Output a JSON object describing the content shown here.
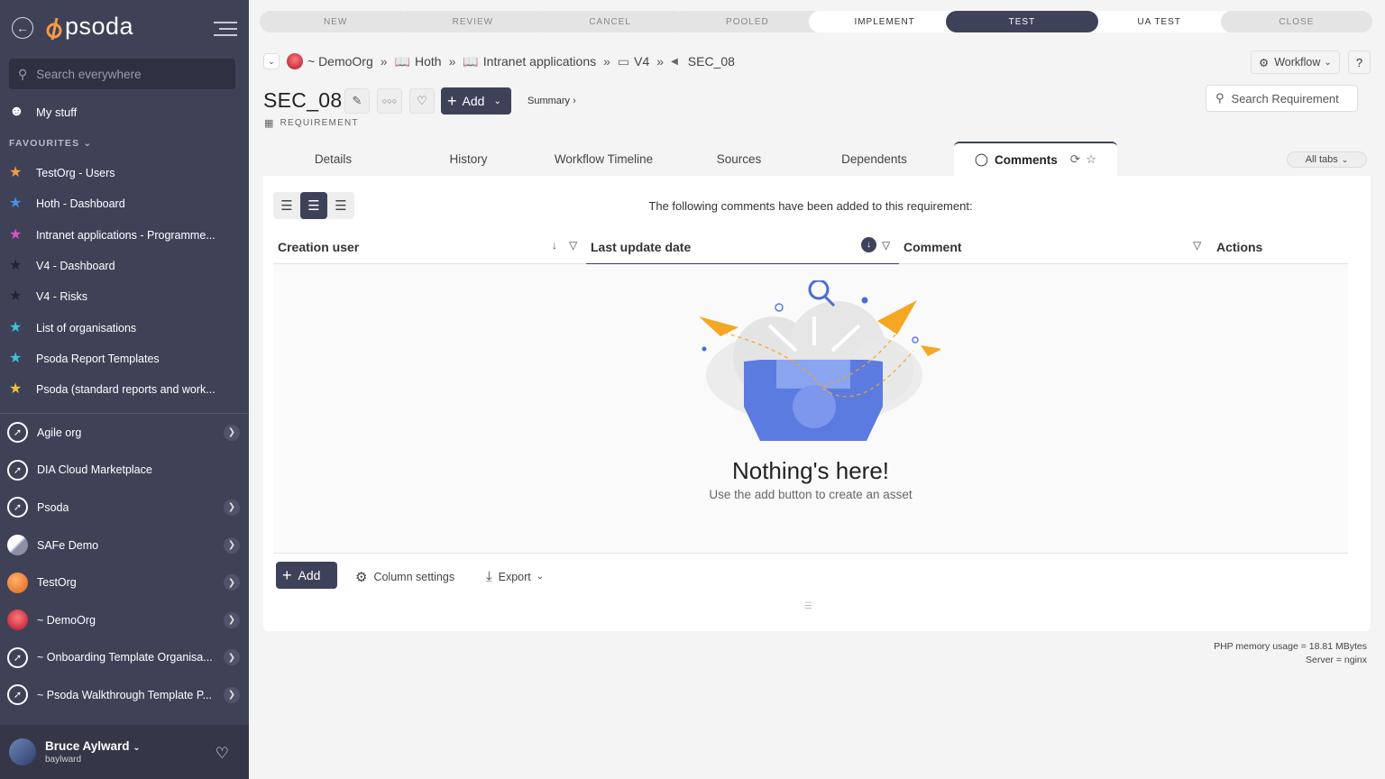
{
  "app": {
    "logo_text": "psoda"
  },
  "sidebar": {
    "search_placeholder": "Search everywhere",
    "my_stuff": "My stuff",
    "favourites_header": "FAVOURITES",
    "favourites": [
      {
        "label": "TestOrg - Users",
        "color": "#f39a4a"
      },
      {
        "label": "Hoth - Dashboard",
        "color": "#4a90e2"
      },
      {
        "label": "Intranet applications - Programme...",
        "color": "#d94fd1"
      },
      {
        "label": "V4 - Dashboard",
        "color": "#2a2c38"
      },
      {
        "label": "V4 - Risks",
        "color": "#2a2c38"
      },
      {
        "label": "List of organisations",
        "color": "#38c3d8"
      },
      {
        "label": "Psoda Report Templates",
        "color": "#38c3d8"
      },
      {
        "label": "Psoda (standard reports and work...",
        "color": "#f0c23a"
      }
    ],
    "orgs": [
      {
        "label": "Agile org",
        "chevron": true
      },
      {
        "label": "DIA Cloud Marketplace",
        "chevron": false
      },
      {
        "label": "Psoda",
        "chevron": true
      },
      {
        "label": "SAFe Demo",
        "chevron": true
      },
      {
        "label": "TestOrg",
        "chevron": true
      },
      {
        "label": "~ DemoOrg",
        "chevron": true
      },
      {
        "label": "~ Onboarding Template Organisa...",
        "chevron": true
      },
      {
        "label": "~ Psoda Walkthrough Template P...",
        "chevron": true
      }
    ],
    "user_name": "Bruce Aylward",
    "user_id": "baylward"
  },
  "workflow": [
    "NEW",
    "REVIEW",
    "CANCEL",
    "POOLED",
    "IMPLEMENT",
    "TEST",
    "UA TEST",
    "CLOSE"
  ],
  "breadcrumb": {
    "org": "~ DemoOrg",
    "item2": "Hoth",
    "item3": "Intranet applications",
    "item4": "V4",
    "current": "SEC_08"
  },
  "header": {
    "workflow_btn": "Workflow",
    "help": "?",
    "title": "SEC_08",
    "add": "Add",
    "summary": "Summary ›",
    "type": "REQUIREMENT",
    "search_placeholder": "Search Requirement"
  },
  "tabs": {
    "details": "Details",
    "history": "History",
    "timeline": "Workflow Timeline",
    "sources": "Sources",
    "dependents": "Dependents",
    "comments": "Comments",
    "all": "All tabs"
  },
  "panel": {
    "intro": "The following comments have been added to this requirement:",
    "col1": "Creation user",
    "col2": "Last update date",
    "col3": "Comment",
    "col4": "Actions",
    "empty_title": "Nothing's here!",
    "empty_sub": "Use the add button to create an asset",
    "add": "Add",
    "column_settings": "Column settings",
    "export": "Export"
  },
  "footer": {
    "memory": "PHP memory usage = 18.81 MBytes",
    "server": "Server = nginx"
  }
}
